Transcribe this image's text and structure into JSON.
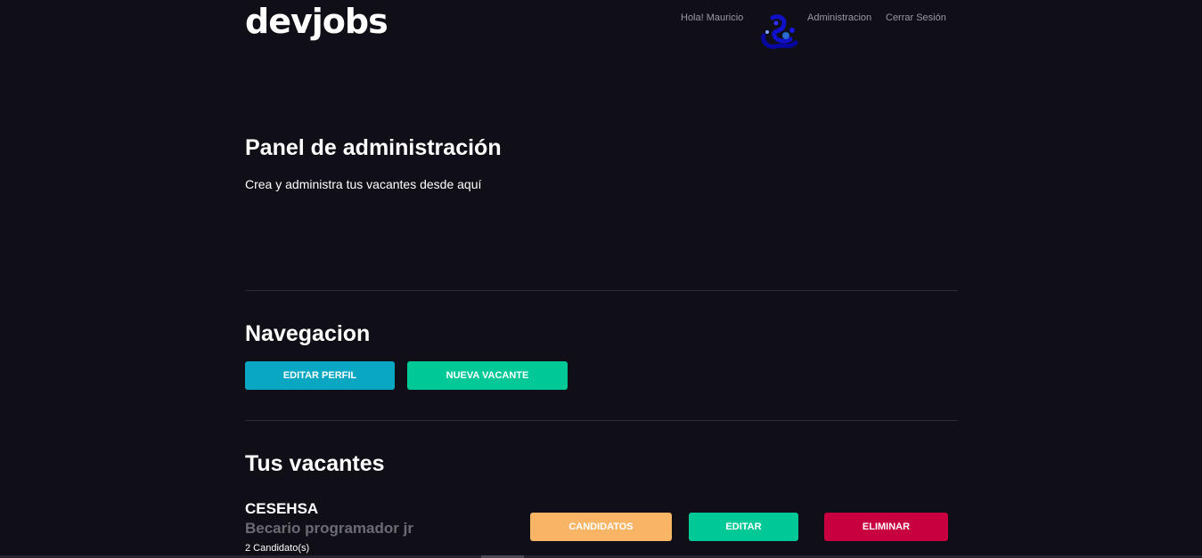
{
  "header": {
    "logo": "devjobs",
    "greeting": "Hola! Mauricio",
    "nav": {
      "admin": "Administracion",
      "logout": "Cerrar Sesión"
    }
  },
  "panel": {
    "title": "Panel de administración",
    "subtitle": "Crea y administra tus vacantes desde aquí"
  },
  "navigation": {
    "title": "Navegacion",
    "edit_profile": "EDITAR PERFIL",
    "new_job": "NUEVA VACANTE"
  },
  "jobs": {
    "title": "Tus vacantes",
    "items": [
      {
        "company": "CESEHSA",
        "position": "Becario programador jr",
        "candidates": "2 Candidato(s)",
        "candidates_button": "CANDIDATOS",
        "edit_button": "EDITAR",
        "delete_button": "ELIMINAR"
      }
    ]
  },
  "colors": {
    "background": "#100f17",
    "edit_profile": "#0aa7c2",
    "new_job": "#00c896",
    "candidates": "#f7b565",
    "edit": "#00c896",
    "delete": "#c8003f"
  }
}
